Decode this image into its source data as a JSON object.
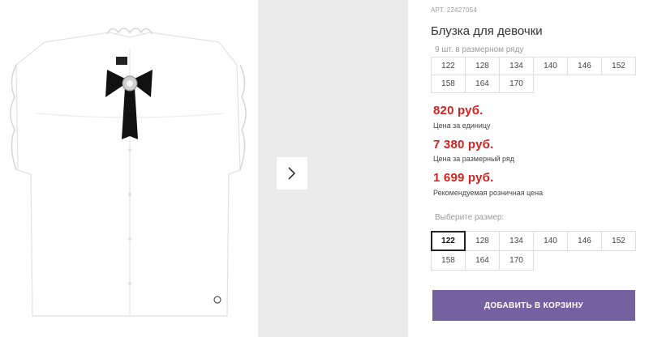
{
  "product": {
    "article_label": "АРТ. 22427054",
    "title": "Блузка для девочки",
    "series_note": "9 шт. в размерном ряду",
    "series_sizes": [
      "122",
      "128",
      "134",
      "140",
      "146",
      "152",
      "158",
      "164",
      "170"
    ],
    "prices": [
      {
        "value": "820 руб.",
        "label": "Цена за единицу"
      },
      {
        "value": "7 380 руб.",
        "label": "Цена за размерный ряд"
      },
      {
        "value": "1 699 руб.",
        "label": "Рекомендуемая розничная цена"
      }
    ],
    "choose_size_label": "Выберите размер:",
    "size_options": [
      "122",
      "128",
      "134",
      "140",
      "146",
      "152",
      "158",
      "164",
      "170"
    ],
    "selected_size": "122",
    "add_to_cart_label": "ДОБАВИТЬ В КОРЗИНУ"
  },
  "gallery": {
    "next_icon": "chevron-right-icon"
  },
  "colors": {
    "price": "#d8201f",
    "button": "#7461a0"
  }
}
